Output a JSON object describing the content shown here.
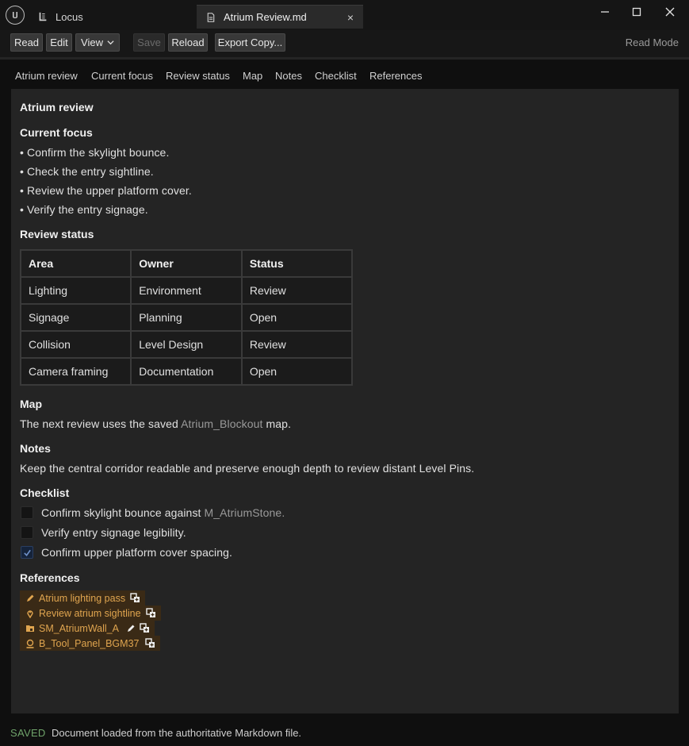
{
  "titlebar": {
    "app_tab": "Locus",
    "doc_tab": "Atrium Review.md",
    "close_glyph": "×"
  },
  "toolbar": {
    "read": "Read",
    "edit": "Edit",
    "view": "View",
    "save": "Save",
    "reload": "Reload",
    "export": "Export Copy...",
    "mode": "Read Mode"
  },
  "nav": [
    "Atrium review",
    "Current focus",
    "Review status",
    "Map",
    "Notes",
    "Checklist",
    "References"
  ],
  "doc": {
    "title": "Atrium review",
    "focus_heading": "Current focus",
    "focus_items": [
      "• Confirm the skylight bounce.",
      "• Check the entry sightline.",
      "• Review the upper platform cover.",
      "• Verify the entry signage."
    ],
    "status_heading": "Review status",
    "table": {
      "headers": [
        "Area",
        "Owner",
        "Status"
      ],
      "rows": [
        [
          "Lighting",
          "Environment",
          "Review"
        ],
        [
          "Signage",
          "Planning",
          "Open"
        ],
        [
          "Collision",
          "Level Design",
          "Review"
        ],
        [
          "Camera framing",
          "Documentation",
          "Open"
        ]
      ]
    },
    "map_heading": "Map",
    "map_text_pre": "The next review uses the saved ",
    "map_link": "Atrium_Blockout",
    "map_text_post": " map.",
    "notes_heading": "Notes",
    "notes_text": "Keep the central corridor readable and preserve enough depth to review distant Level Pins.",
    "checklist_heading": "Checklist",
    "checklist": [
      {
        "pre": "Confirm skylight bounce against ",
        "ref": "M_AtriumStone",
        "post": ".",
        "checked": false
      },
      {
        "pre": "Verify entry signage legibility.",
        "ref": "",
        "post": "",
        "checked": false
      },
      {
        "pre": "Confirm upper platform cover spacing.",
        "ref": "",
        "post": "",
        "checked": true
      }
    ],
    "references_heading": "References",
    "references": [
      {
        "label": "Atrium lighting pass",
        "icon": "pencil-icon"
      },
      {
        "label": "Review atrium sightline",
        "icon": "pin-icon"
      },
      {
        "label": "SM_AtriumWall_A",
        "icon": "mesh-icon"
      },
      {
        "label": "B_Tool_Panel_BGM37",
        "icon": "blueprint-icon"
      }
    ]
  },
  "status": {
    "state": "SAVED",
    "message": "Document loaded from the authoritative Markdown file."
  },
  "colors": {
    "accent_ref": "#e0a54f",
    "saved_green": "#6fa36a",
    "panel": "#242424"
  }
}
